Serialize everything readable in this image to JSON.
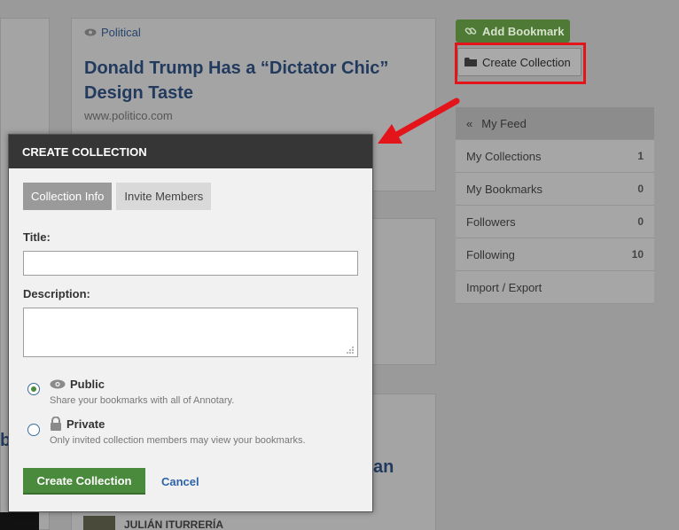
{
  "feed": {
    "main_card": {
      "category": "Political",
      "headline": "Donald Trump Has a “Dictator Chic” Design Taste",
      "domain": "www.politico.com"
    },
    "bottom_fragment_left": "b",
    "bottom_fragment_right": "an",
    "author": "JULIÁN ITURRERÍA"
  },
  "right_column": {
    "add_bookmark_label": "Add Bookmark",
    "create_collection_label": "Create Collection",
    "nav": [
      {
        "label": "My Feed",
        "prefix": "«",
        "count": ""
      },
      {
        "label": "My Collections",
        "count": "1"
      },
      {
        "label": "My Bookmarks",
        "count": "0"
      },
      {
        "label": "Followers",
        "count": "0"
      },
      {
        "label": "Following",
        "count": "10"
      },
      {
        "label": "Import / Export",
        "count": ""
      }
    ]
  },
  "modal": {
    "title": "CREATE COLLECTION",
    "tabs": [
      {
        "label": "Collection Info",
        "active": true
      },
      {
        "label": "Invite Members",
        "active": false
      }
    ],
    "title_label": "Title:",
    "title_value": "",
    "description_label": "Description:",
    "description_value": "",
    "visibility": {
      "selected": "public",
      "public": {
        "label": "Public",
        "description": "Share your bookmarks with all of Annotary."
      },
      "private": {
        "label": "Private",
        "description": "Only invited collection members may view your bookmarks."
      }
    },
    "submit_label": "Create Collection",
    "cancel_label": "Cancel"
  },
  "annotation": {
    "highlight_color": "#e4141b"
  },
  "colors": {
    "accent_green": "#4a8a3c",
    "link_blue": "#2e62a8",
    "header_dark": "#363636"
  }
}
